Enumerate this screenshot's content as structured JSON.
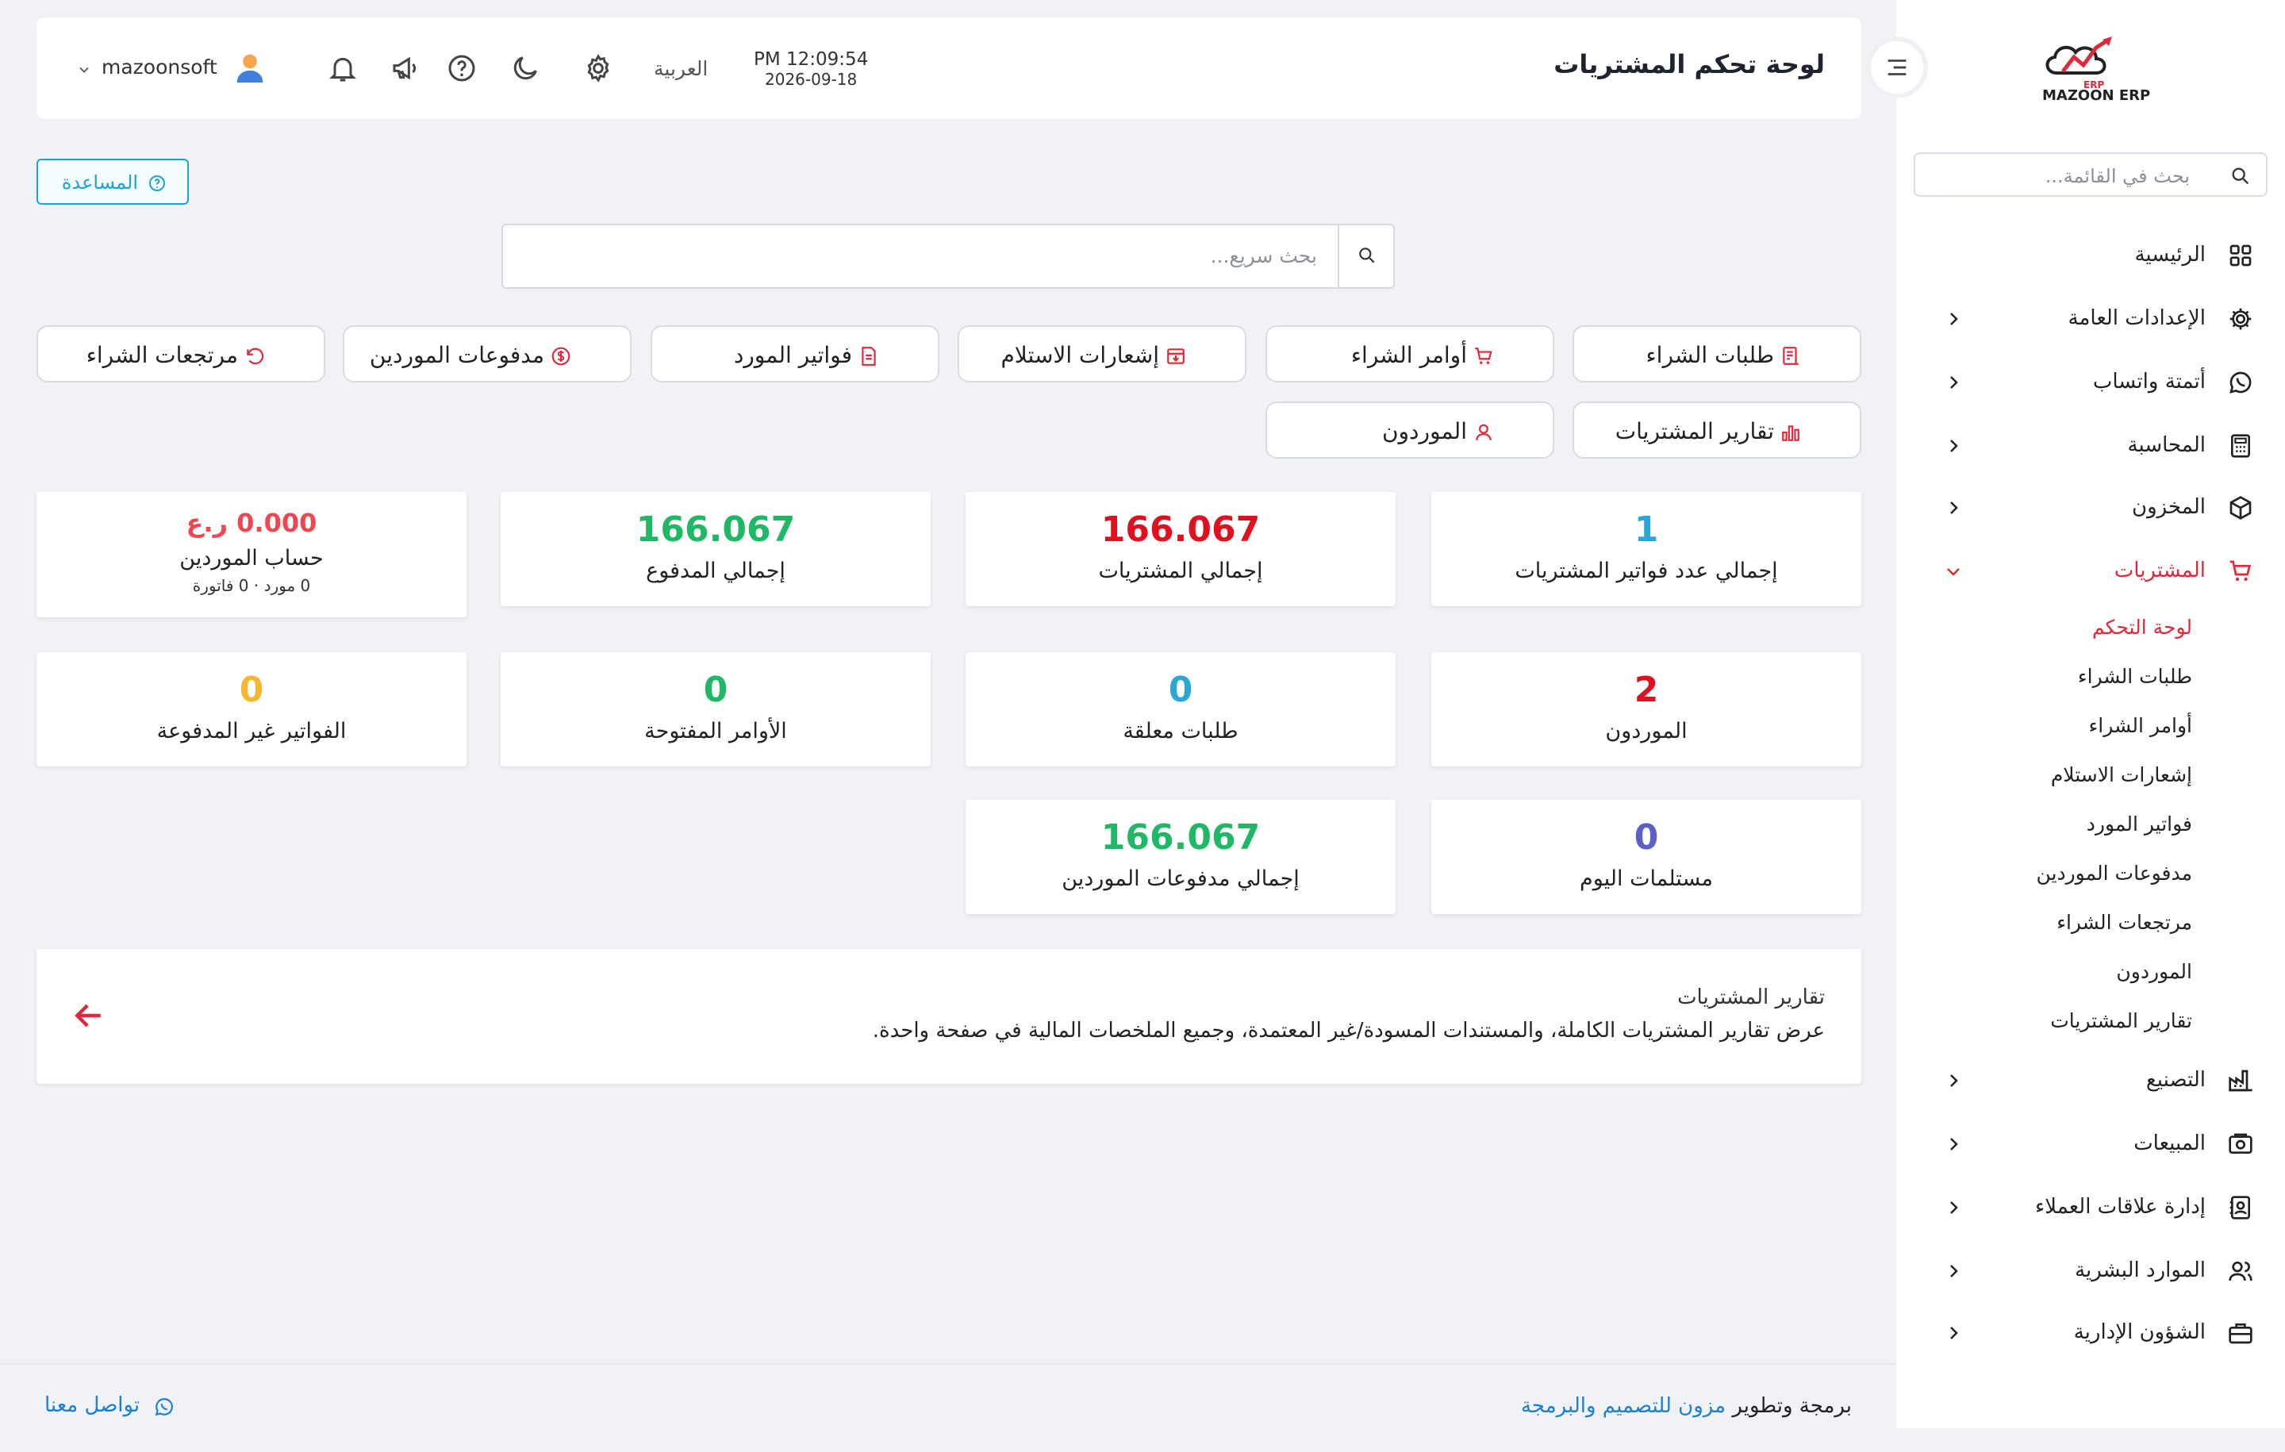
{
  "brand": {
    "name": "MAZOON ERP",
    "tagline": "ERP"
  },
  "sidebar": {
    "search_placeholder": "بحث في القائمة...",
    "items": [
      {
        "label": "الرئيسية",
        "icon": "grid-icon"
      },
      {
        "label": "الإعدادات العامة",
        "icon": "gear-icon"
      },
      {
        "label": "أتمتة واتساب",
        "icon": "whatsapp-icon"
      },
      {
        "label": "المحاسبة",
        "icon": "calculator-icon"
      },
      {
        "label": "المخزون",
        "icon": "box-icon"
      },
      {
        "label": "المشتريات",
        "icon": "cart-icon"
      },
      {
        "label": "التصنيع",
        "icon": "factory-icon"
      },
      {
        "label": "المبيعات",
        "icon": "sales-icon"
      },
      {
        "label": "إدارة علاقات العملاء",
        "icon": "contacts-icon"
      },
      {
        "label": "الموارد البشرية",
        "icon": "users-icon"
      },
      {
        "label": "الشؤون الإدارية",
        "icon": "briefcase-icon"
      }
    ],
    "purchases_sub": [
      "لوحة التحكم",
      "طلبات الشراء",
      "أوامر الشراء",
      "إشعارات الاستلام",
      "فواتير المورد",
      "مدفوعات الموردين",
      "مرتجعات الشراء",
      "الموردون",
      "تقارير المشتريات"
    ]
  },
  "header": {
    "title": "لوحة تحكم المشتريات",
    "time": "PM 12:09:54",
    "date": "2026-09-18",
    "language": "العربية",
    "username": "mazoonsoft"
  },
  "help_label": "المساعدة",
  "quick_search_placeholder": "بحث سريع...",
  "quick_links": [
    {
      "label": "طلبات الشراء",
      "icon": "list-icon"
    },
    {
      "label": "أوامر الشراء",
      "icon": "cart-icon"
    },
    {
      "label": "إشعارات الاستلام",
      "icon": "inbox-icon"
    },
    {
      "label": "فواتير المورد",
      "icon": "invoice-icon"
    },
    {
      "label": "مدفوعات الموردين",
      "icon": "dollar-icon"
    },
    {
      "label": "مرتجعات الشراء",
      "icon": "undo-icon"
    },
    {
      "label": "تقارير المشتريات",
      "icon": "bar-chart-icon"
    },
    {
      "label": "الموردون",
      "icon": "user-icon"
    }
  ],
  "stats": [
    {
      "value": "1",
      "label": "إجمالي عدد فواتير المشتريات",
      "color": "#2aa7d8"
    },
    {
      "value": "166.067",
      "label": "إجمالي المشتريات",
      "color": "#e0101f"
    },
    {
      "value": "166.067",
      "label": "إجمالي المدفوع",
      "color": "#1fb864"
    },
    {
      "value": "0.000 ر.ع",
      "label": "حساب الموردين",
      "sub": "0 مورد · 0 فاتورة",
      "color": "#f0464f"
    },
    {
      "value": "2",
      "label": "الموردون",
      "color": "#e0101f"
    },
    {
      "value": "0",
      "label": "طلبات معلقة",
      "color": "#2aa7d8"
    },
    {
      "value": "0",
      "label": "الأوامر المفتوحة",
      "color": "#1fb864"
    },
    {
      "value": "0",
      "label": "الفواتير غير المدفوعة",
      "color": "#f5b731"
    },
    {
      "value": "0",
      "label": "مستلمات اليوم",
      "color": "#5b5fc7"
    },
    {
      "value": "166.067",
      "label": "إجمالي مدفوعات الموردين",
      "color": "#1fb864"
    }
  ],
  "reports_card": {
    "title": "تقارير المشتريات",
    "description": "عرض تقارير المشتريات الكاملة، والمستندات المسودة/غير المعتمدة، وجميع الملخصات المالية في صفحة واحدة."
  },
  "footer": {
    "credit_prefix": "برمجة وتطوير",
    "credit_link": "مزون للتصميم والبرمجة",
    "contact": "تواصل معنا"
  },
  "colors": {
    "accent": "#e0283a",
    "link": "#1a7fd6",
    "help": "#1aa3d6"
  }
}
